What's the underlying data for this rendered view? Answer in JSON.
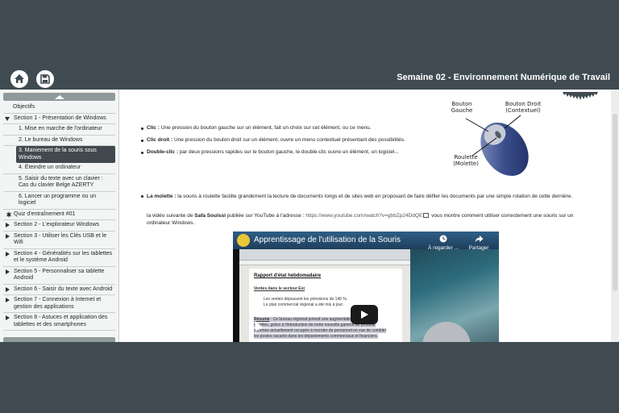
{
  "header": {
    "title": "Semaine 02 - Environnement Numérique de Travail",
    "home_icon": "home-icon",
    "save_icon": "save-icon"
  },
  "sidebar": {
    "items": [
      {
        "label": "Objectifs",
        "type": "plain"
      },
      {
        "label": "Section 1 - Présentation de Windows",
        "type": "section-open"
      },
      {
        "label": "1. Mise en marche de l'ordinateur",
        "type": "sub"
      },
      {
        "label": "2. Le bureau de Windows",
        "type": "sub"
      },
      {
        "label": "3. Maniement de la souris sous Windows",
        "type": "sub-selected"
      },
      {
        "label": "4. Éteindre un ordinateur",
        "type": "sub"
      },
      {
        "label": "5. Saisir du texte avec un clavier : Cas du clavier Belge AZERTY",
        "type": "sub"
      },
      {
        "label": "6. Lancer un programme ou un logiciel",
        "type": "sub"
      },
      {
        "label": "Quiz d'entraînement #01",
        "type": "quiz"
      },
      {
        "label": "Section 2 - L'explorateur Windows",
        "type": "section"
      },
      {
        "label": "Section 3 - Utiliser les Clés USB et le Wifi",
        "type": "section"
      },
      {
        "label": "Section 4 - Généralités sur les tablettes et le système Android",
        "type": "section"
      },
      {
        "label": "Section 5 - Personnaliser sa tablette Android",
        "type": "section"
      },
      {
        "label": "Section 6 - Saisir du texte avec Android",
        "type": "section"
      },
      {
        "label": "Section 7 - Connexion à Internet et gestion des applications",
        "type": "section"
      },
      {
        "label": "Section 8 - Astuces et application des tablettes et des smartphones",
        "type": "section"
      }
    ]
  },
  "content": {
    "clic_term": "Clic :",
    "clic_text": " Une pression du bouton gauche sur un élément, fait un choix sur cet élément, ou ce menu.",
    "clic_droit_term": "Clic droit :",
    "clic_droit_text": " Une pression du bouton droit sur un élément, ouvre un menu contextuel présentant des possibilités.",
    "double_clic_term": "Double-clic :",
    "double_clic_text": " par deux pressions rapides sur le bouton gauche, le double-clic ouvre un élément, un logiciel...",
    "mouse_labels": {
      "left": "Bouton\nGauche",
      "right": "Bouton Droit\n(Contextuel)",
      "wheel": "Roulette\n(Molette)"
    },
    "molette_term": "La molette :",
    "molette_text": " la souris à roulette facilite grandement la lecture de documents longs et de sites web en proposant de faire défiler les documents par une simple rotation de cette dernière.",
    "video_intro_1": "la vidéo suivante de ",
    "video_author": "Safa Souissi",
    "video_intro_2": " publiée sur YouTube à l'adresse : ",
    "video_url": "https://www.youtube.com/watch?v=gbbZp24DdQE",
    "video_intro_3": " vous montre comment utiliser correctement une souris sur un ordinateur Windows."
  },
  "video": {
    "title": "Apprentissage de l'utilisation de la Souris",
    "watch_later": "À regarder ...",
    "share": "Partager",
    "doc_heading": "Rapport d'état hebdomadaire",
    "doc_subheading": "Ventes dans le secteur Est",
    "doc_line1": "Les ventes dépassent les prévisions de 140 %.",
    "doc_line2": "Le plan commercial régional a été mis à jour.",
    "doc_summary_label": "Résumé",
    "doc_summary_1": " : Ce bureau régional prévoit une augmentation",
    "doc_summary_2": "recettes, grâce à l'introduction de notre nouvelle gamme de produits",
    "doc_summary_3": "sommes actuellement occupés à recruter du personnel en vue de combler",
    "doc_summary_4": "les postes vacants dans les départements commerciaux et financiers."
  }
}
